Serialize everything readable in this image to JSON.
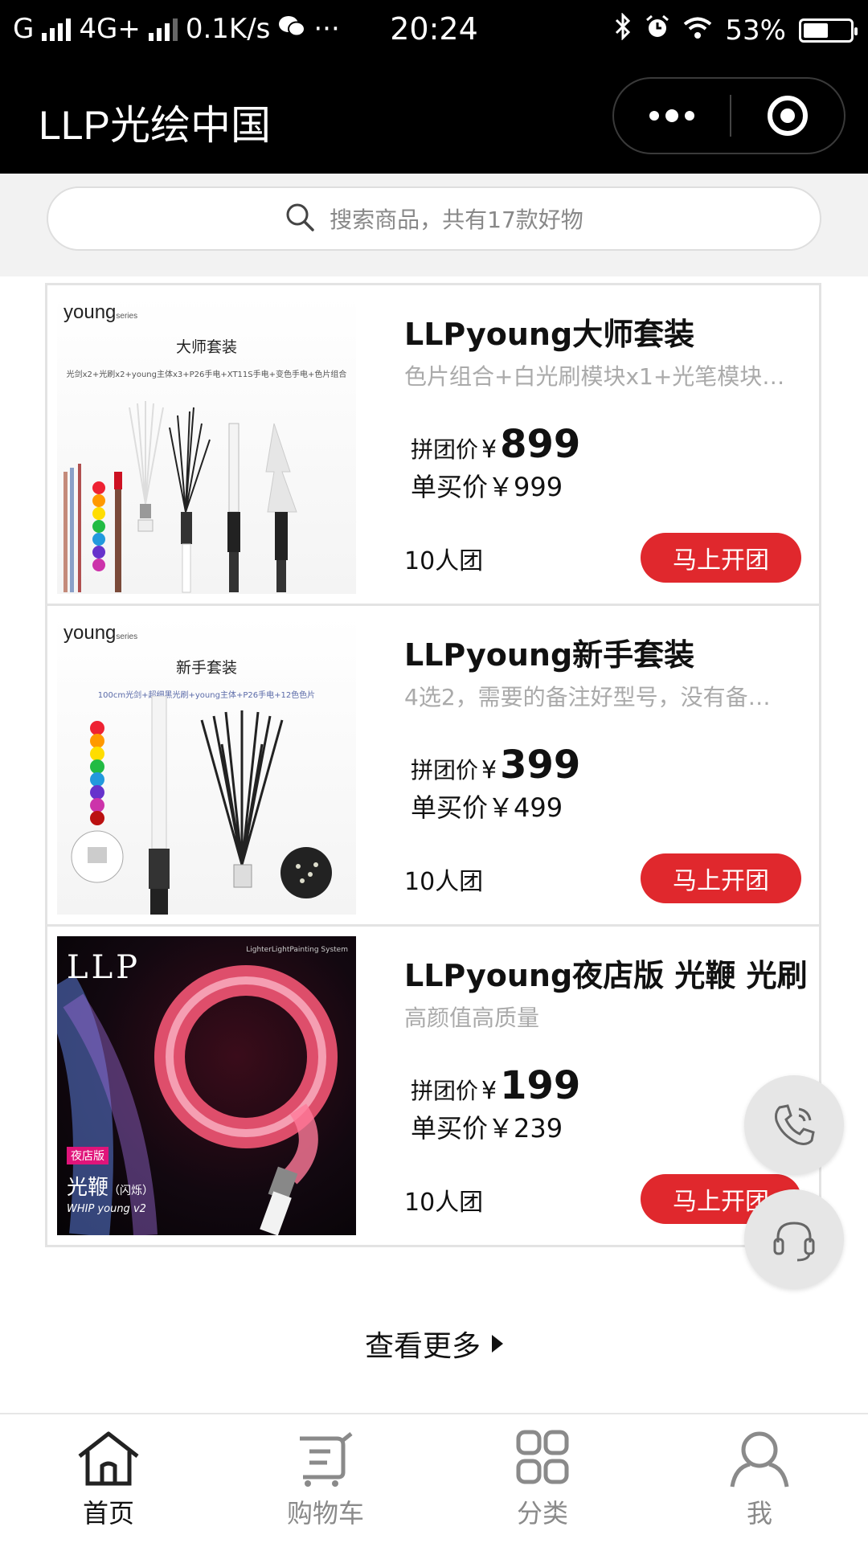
{
  "status_bar": {
    "carrier": "G",
    "network": "4G+",
    "speed": "0.1K/s",
    "more": "···",
    "time": "20:24",
    "battery": "53%",
    "battery_level": 0.53
  },
  "header": {
    "title": "LLP光绘中国"
  },
  "search": {
    "placeholder": "搜索商品，共有17款好物"
  },
  "products": [
    {
      "name": "LLPyoung大师套装",
      "description": "色片组合+白光刷模块x1+光笔模块…",
      "group_price_label": "拼团价",
      "currency": "¥",
      "group_price": "899",
      "single_price_text": "单买价￥999",
      "group_size": "10人团",
      "button_label": "马上开团",
      "thumb": {
        "brand": "young",
        "brand_sub": "series",
        "kit": "大师套装",
        "spec": "光剑x2+光刷x2+young主体x3+P26手电+XT11S手电+变色手电+色片组合"
      }
    },
    {
      "name": "LLPyoung新手套装",
      "description": "4选2，需要的备注好型号，没有备…",
      "group_price_label": "拼团价",
      "currency": "¥",
      "group_price": "399",
      "single_price_text": "单买价￥499",
      "group_size": "10人团",
      "button_label": "马上开团",
      "thumb": {
        "brand": "young",
        "brand_sub": "series",
        "kit": "新手套装",
        "spec": "100cm光剑+超细黑光刷+young主体+P26手电+12色色片"
      }
    },
    {
      "name": "LLPyoung夜店版 光鞭 光刷",
      "description": "高颜值高质量",
      "group_price_label": "拼团价",
      "currency": "¥",
      "group_price": "199",
      "single_price_text": "单买价￥239",
      "group_size": "10人团",
      "button_label": "马上开团",
      "thumb": {
        "logo": "LLP",
        "system": "LighterLightPainting System",
        "tag": "夜店版",
        "whip_cn": "光鞭",
        "whip_cn_sub": "（闪烁）",
        "whip_en": "WHIP young v2"
      }
    }
  ],
  "view_more": {
    "label": "查看更多"
  },
  "tab_bar": {
    "items": [
      {
        "label": "首页",
        "icon": "home-icon",
        "active": true
      },
      {
        "label": "购物车",
        "icon": "cart-icon",
        "active": false
      },
      {
        "label": "分类",
        "icon": "category-icon",
        "active": false
      },
      {
        "label": "我",
        "icon": "profile-icon",
        "active": false
      }
    ]
  },
  "colors": {
    "accent": "#e0282d",
    "header_bg": "#000000",
    "inactive_tab": "#8a8a8a"
  }
}
